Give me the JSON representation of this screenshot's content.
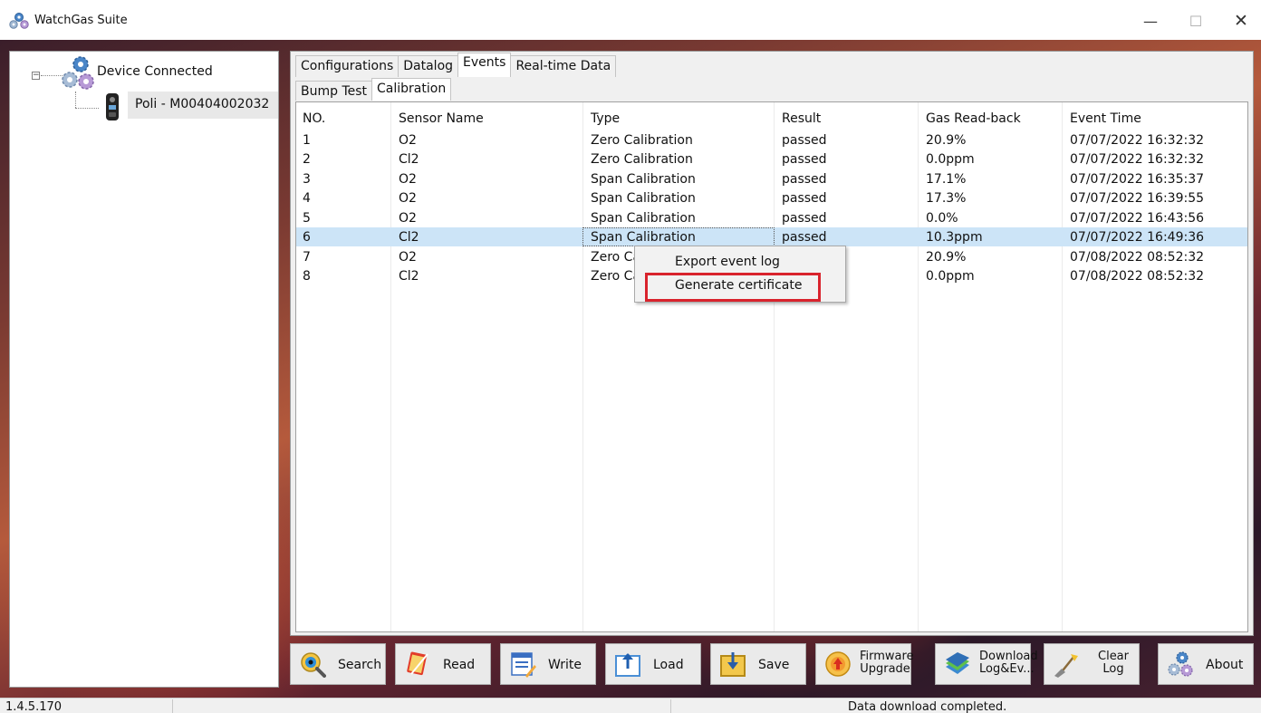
{
  "window": {
    "title": "WatchGas Suite",
    "minimize_glyph": "—",
    "maximize_glyph": "☐",
    "close_glyph": "✕"
  },
  "tree": {
    "expander_glyph": "−",
    "root_label": "Device Connected",
    "device_label": "Poli - M00404002032",
    "root_icon": "gears-icon",
    "device_icon": "gas-detector-icon"
  },
  "tabs": [
    "Configurations",
    "Datalog",
    "Events",
    "Real-time Data"
  ],
  "active_tab": "Events",
  "subtabs": [
    "Bump Test",
    "Calibration"
  ],
  "active_subtab": "Calibration",
  "table": {
    "columns": [
      "NO.",
      "Sensor Name",
      "Type",
      "Result",
      "Gas Read-back",
      "Event Time"
    ],
    "rows": [
      [
        "1",
        "O2",
        "Zero Calibration",
        "passed",
        "20.9%",
        "07/07/2022 16:32:32"
      ],
      [
        "2",
        "Cl2",
        "Zero Calibration",
        "passed",
        "0.0ppm",
        "07/07/2022 16:32:32"
      ],
      [
        "3",
        "O2",
        "Span Calibration",
        "passed",
        "17.1%",
        "07/07/2022 16:35:37"
      ],
      [
        "4",
        "O2",
        "Span Calibration",
        "passed",
        "17.3%",
        "07/07/2022 16:39:55"
      ],
      [
        "5",
        "O2",
        "Span Calibration",
        "passed",
        "0.0%",
        "07/07/2022 16:43:56"
      ],
      [
        "6",
        "Cl2",
        "Span Calibration",
        "passed",
        "10.3ppm",
        "07/07/2022 16:49:36"
      ],
      [
        "7",
        "O2",
        "Zero Ca",
        "",
        "20.9%",
        "07/08/2022 08:52:32"
      ],
      [
        "8",
        "Cl2",
        "Zero Ca",
        "",
        "0.0ppm",
        "07/08/2022 08:52:32"
      ]
    ],
    "selected_row": 6
  },
  "context_menu": {
    "items": [
      "Export event log",
      "Generate certificate"
    ],
    "highlighted_item": "Generate certificate",
    "highlight_color": "#d9232d"
  },
  "toolbar": {
    "buttons": [
      {
        "label": "Search",
        "icon": "search-icon"
      },
      {
        "label": "Read",
        "icon": "read-icon"
      },
      {
        "label": "Write",
        "icon": "write-icon"
      },
      {
        "label": "Load",
        "icon": "load-icon"
      },
      {
        "label": "Save",
        "icon": "save-icon"
      },
      {
        "label": "Firmware\nUpgrade",
        "icon": "firmware-upgrade-icon"
      },
      {
        "label": "Download\nLog&Ev...",
        "icon": "download-books-icon"
      },
      {
        "label": "Clear\nLog",
        "icon": "broom-icon"
      },
      {
        "label": "About",
        "icon": "gears-icon"
      }
    ]
  },
  "statusbar": {
    "version": "1.4.5.170",
    "status": "Data download completed."
  },
  "colors": {
    "selection": "#cce4f7",
    "panel_border": "#9a9a9a"
  }
}
